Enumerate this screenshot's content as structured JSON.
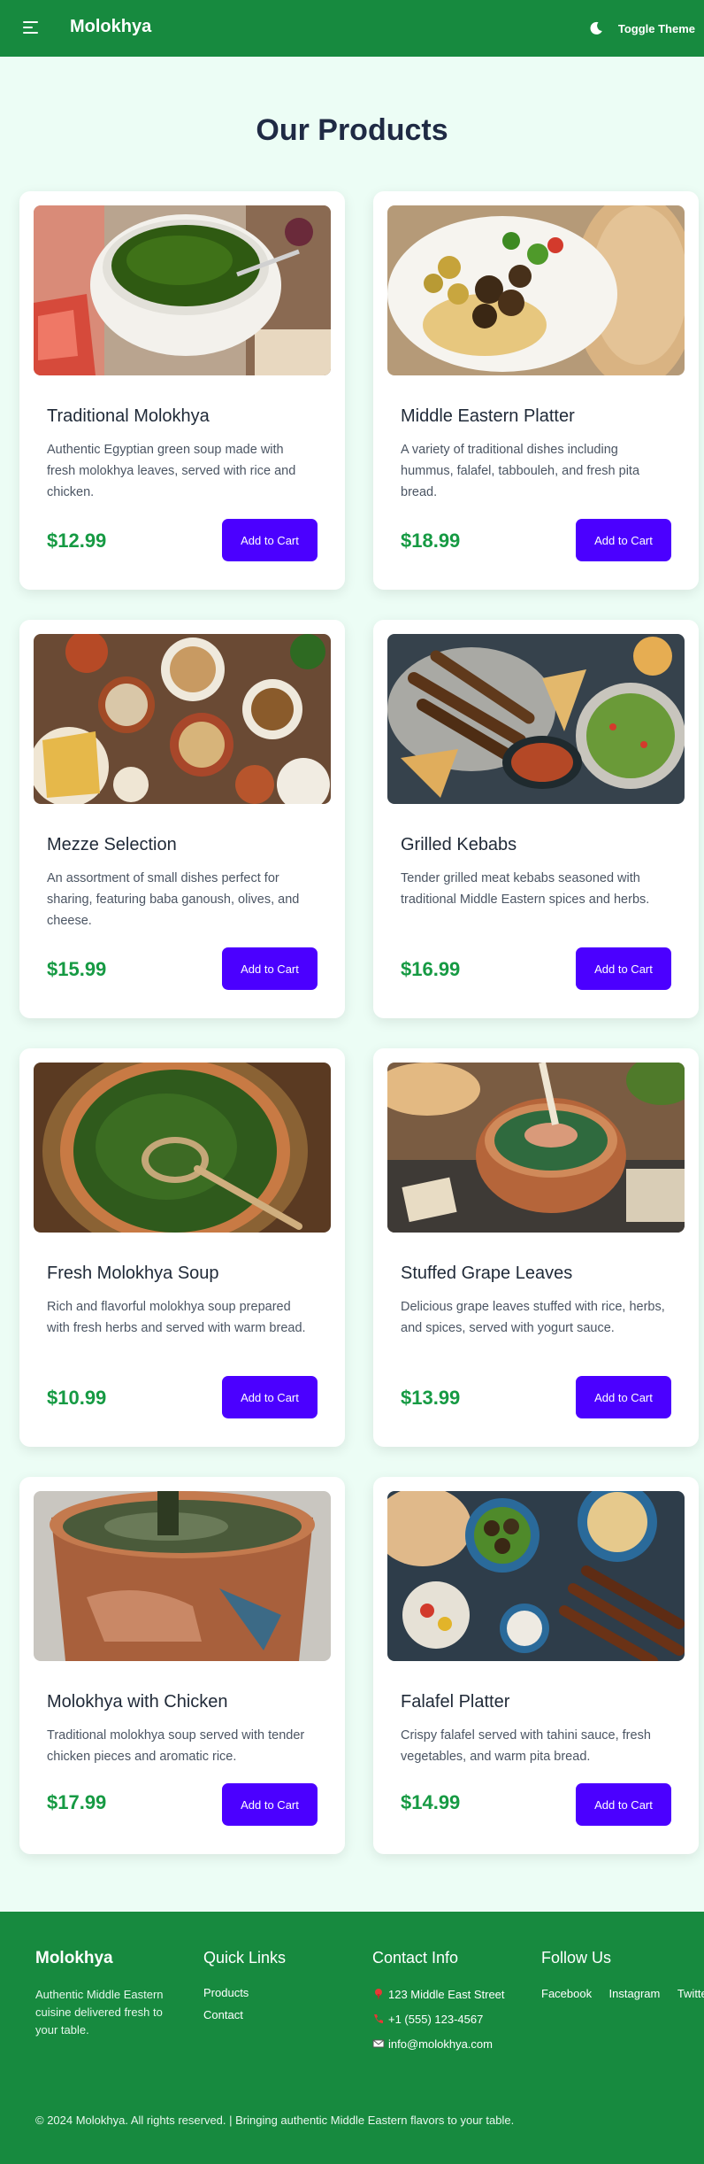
{
  "nav": {
    "brand": "Molokhya",
    "theme_label": "Toggle Theme",
    "menu_icon": "hamburger-menu-icon",
    "theme_icon": "moon-icon"
  },
  "page": {
    "title": "Our Products"
  },
  "products": [
    {
      "title": "Traditional Molokhya",
      "desc": "Authentic Egyptian green soup made with fresh molokhya leaves, served with rice and chicken.",
      "price": "$12.99",
      "button": "Add to Cart"
    },
    {
      "title": "Middle Eastern Platter",
      "desc": "A variety of traditional dishes including hummus, falafel, tabbouleh, and fresh pita bread.",
      "price": "$18.99",
      "button": "Add to Cart"
    },
    {
      "title": "Mezze Selection",
      "desc": "An assortment of small dishes perfect for sharing, featuring baba ganoush, olives, and cheese.",
      "price": "$15.99",
      "button": "Add to Cart"
    },
    {
      "title": "Grilled Kebabs",
      "desc": "Tender grilled meat kebabs seasoned with traditional Middle Eastern spices and herbs.",
      "price": "$16.99",
      "button": "Add to Cart"
    },
    {
      "title": "Fresh Molokhya Soup",
      "desc": "Rich and flavorful molokhya soup prepared with fresh herbs and served with warm bread.",
      "price": "$10.99",
      "button": "Add to Cart"
    },
    {
      "title": "Stuffed Grape Leaves",
      "desc": "Delicious grape leaves stuffed with rice, herbs, and spices, served with yogurt sauce.",
      "price": "$13.99",
      "button": "Add to Cart"
    },
    {
      "title": "Molokhya with Chicken",
      "desc": "Traditional molokhya soup served with tender chicken pieces and aromatic rice.",
      "price": "$17.99",
      "button": "Add to Cart"
    },
    {
      "title": "Falafel Platter",
      "desc": "Crispy falafel served with tahini sauce, fresh vegetables, and warm pita bread.",
      "price": "$14.99",
      "button": "Add to Cart"
    }
  ],
  "footer": {
    "brand": "Molokhya",
    "tagline": "Authentic Middle Eastern cuisine delivered fresh to your table.",
    "quick_links_title": "Quick Links",
    "quick_links": [
      "Products",
      "Contact"
    ],
    "contact_title": "Contact Info",
    "address": "123 Middle East Street",
    "phone": "+1 (555) 123-4567",
    "email": "info@molokhya.com",
    "follow_title": "Follow Us",
    "social": [
      "Facebook",
      "Instagram",
      "Twitter"
    ],
    "copyright": "© 2024 Molokhya. All rights reserved. | Bringing authentic Middle Eastern flavors to your table."
  },
  "colors": {
    "header_green": "#178a3f",
    "page_bg": "#ecfdf5",
    "price_green": "#169a43",
    "button_purple": "#4b00ff"
  }
}
